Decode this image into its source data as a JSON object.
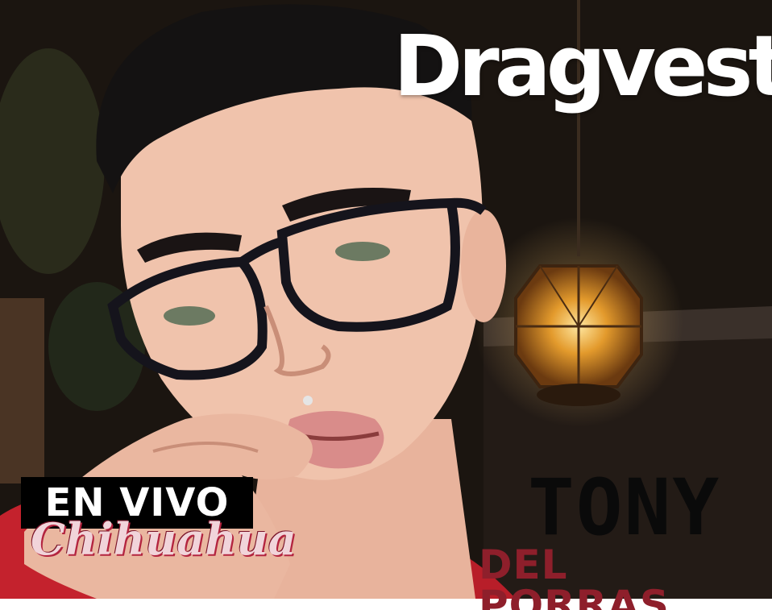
{
  "brand": {
    "logo_text": "Dragvesti"
  },
  "badge": {
    "title": "EN VIVO",
    "city": "Chihuahua"
  },
  "performer": {
    "first_name": "TONY",
    "last_name": "DEL PORRAS"
  },
  "colors": {
    "badge_bg": "#000000",
    "city_text": "#f1d4da",
    "city_outline": "#b3243f",
    "last_name": "#8e1f2b",
    "first_name": "#0a0a0a"
  },
  "icons": [
    "lantern-icon"
  ]
}
